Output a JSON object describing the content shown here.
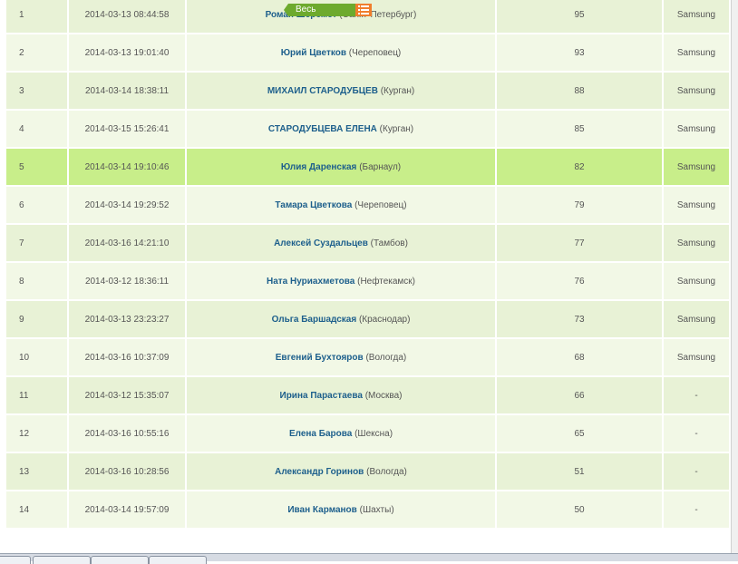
{
  "filter": {
    "label": "Весь",
    "icon": "list-icon"
  },
  "rows": [
    {
      "num": "1",
      "datetime": "2014-03-13 08:44:58",
      "name": "Роман Шеремет",
      "city": "(Санкт-Петербург)",
      "score": "95",
      "prize": "Samsung"
    },
    {
      "num": "2",
      "datetime": "2014-03-13 19:01:40",
      "name": "Юрий Цветков",
      "city": "(Череповец)",
      "score": "93",
      "prize": "Samsung"
    },
    {
      "num": "3",
      "datetime": "2014-03-14 18:38:11",
      "name": "МИХАИЛ СТАРОДУБЦЕВ",
      "city": "(Курган)",
      "score": "88",
      "prize": "Samsung"
    },
    {
      "num": "4",
      "datetime": "2014-03-15 15:26:41",
      "name": "СТАРОДУБЦЕВА ЕЛЕНА",
      "city": "(Курган)",
      "score": "85",
      "prize": "Samsung"
    },
    {
      "num": "5",
      "datetime": "2014-03-14 19:10:46",
      "name": "Юлия Даренская",
      "city": "(Барнаул)",
      "score": "82",
      "prize": "Samsung"
    },
    {
      "num": "6",
      "datetime": "2014-03-14 19:29:52",
      "name": "Тамара Цветкова",
      "city": "(Череповец)",
      "score": "79",
      "prize": "Samsung"
    },
    {
      "num": "7",
      "datetime": "2014-03-16 14:21:10",
      "name": "Алексей Суздальцев",
      "city": "(Тамбов)",
      "score": "77",
      "prize": "Samsung"
    },
    {
      "num": "8",
      "datetime": "2014-03-12 18:36:11",
      "name": "Ната Нуриахметова",
      "city": "(Нефтекамск)",
      "score": "76",
      "prize": "Samsung"
    },
    {
      "num": "9",
      "datetime": "2014-03-13 23:23:27",
      "name": "Ольга Баршадская",
      "city": "(Краснодар)",
      "score": "73",
      "prize": "Samsung"
    },
    {
      "num": "10",
      "datetime": "2014-03-16 10:37:09",
      "name": "Евгений Бухтояров",
      "city": "(Вологда)",
      "score": "68",
      "prize": "Samsung"
    },
    {
      "num": "11",
      "datetime": "2014-03-12 15:35:07",
      "name": "Ирина Парастаева",
      "city": "(Москва)",
      "score": "66",
      "prize": "-"
    },
    {
      "num": "12",
      "datetime": "2014-03-16 10:55:16",
      "name": "Елена Барова",
      "city": "(Шексна)",
      "score": "65",
      "prize": "-"
    },
    {
      "num": "13",
      "datetime": "2014-03-16 10:28:56",
      "name": "Александр Горинов",
      "city": "(Вологда)",
      "score": "51",
      "prize": "-"
    },
    {
      "num": "14",
      "datetime": "2014-03-14 19:57:09",
      "name": "Иван Карманов",
      "city": "(Шахты)",
      "score": "50",
      "prize": "-"
    }
  ],
  "highlight_row": 4,
  "colors": {
    "row_odd": "#e8f2d6",
    "row_even": "#f2f8e6",
    "row_highlight": "#c8ee8a",
    "name_link": "#1d5f8c",
    "filter_bg": "#6daa2e",
    "filter_icon_bg": "#f07e2c"
  }
}
